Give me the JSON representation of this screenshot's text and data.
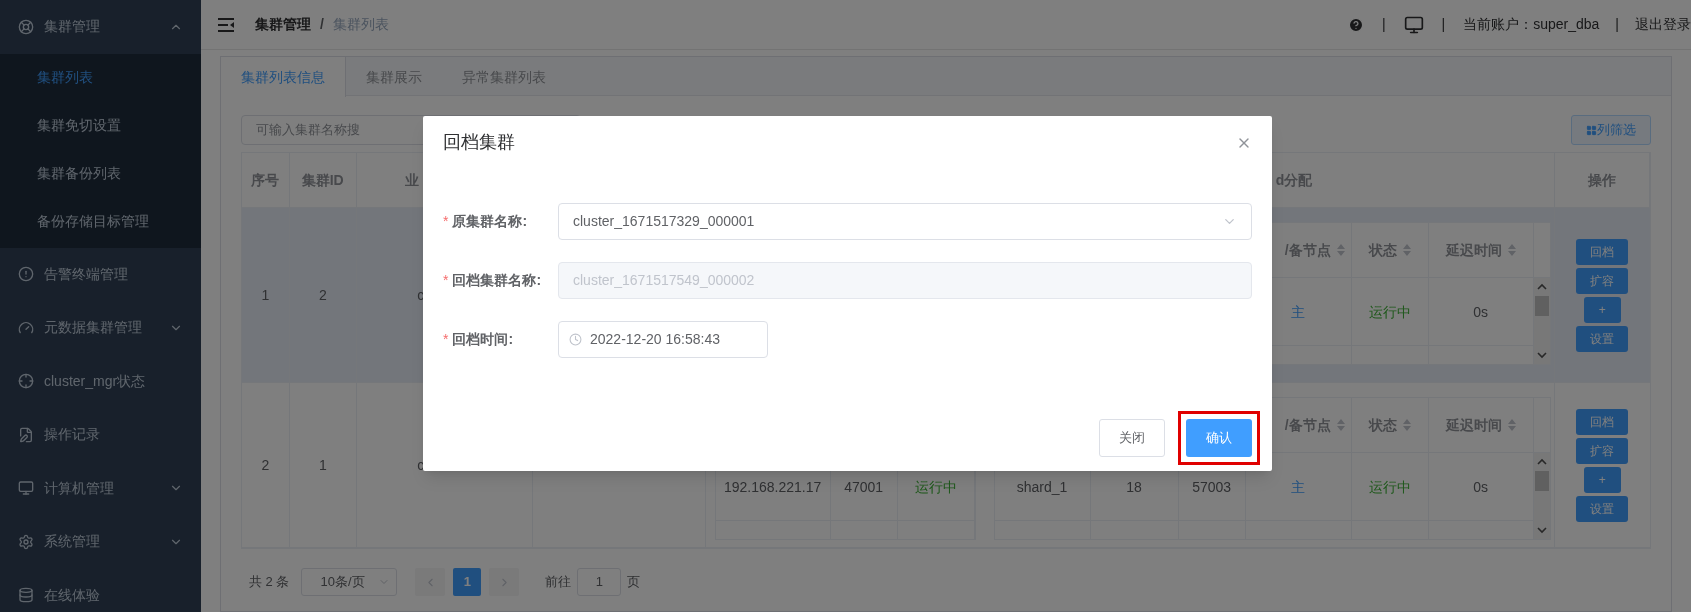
{
  "sidebar": {
    "menu": [
      {
        "label": "集群管理",
        "expanded": true,
        "children": [
          {
            "label": "集群列表",
            "selected": true
          },
          {
            "label": "集群免切设置",
            "selected": false
          },
          {
            "label": "集群备份列表",
            "selected": false
          },
          {
            "label": "备份存储目标管理",
            "selected": false
          }
        ]
      },
      {
        "label": "告警终端管理"
      },
      {
        "label": "元数据集群管理",
        "expanded": false
      },
      {
        "label": "cluster_mgr状态"
      },
      {
        "label": "操作记录"
      },
      {
        "label": "计算机管理",
        "expanded": false
      },
      {
        "label": "系统管理",
        "expanded": false
      },
      {
        "label": "在线体验"
      }
    ]
  },
  "header": {
    "breadcrumb": [
      "集群管理",
      "集群列表"
    ],
    "separator": "/",
    "divider": "|",
    "account": "当前账户：super_dba",
    "logout": "退出登录"
  },
  "tabs": [
    {
      "label": "集群列表信息",
      "selected": true
    },
    {
      "label": "集群展示",
      "selected": false
    },
    {
      "label": "异常集群列表",
      "selected": false
    }
  ],
  "toolbar": {
    "search": {
      "placeholder": "可输入集群名称搜"
    },
    "column_filter": "列筛选"
  },
  "table": {
    "columns": [
      "序号",
      "集群ID",
      "业",
      "",
      "d分配",
      "操作"
    ],
    "rows": [
      {
        "selected": true,
        "cells": [
          "1",
          "2",
          "c",
          ""
        ],
        "left_table": null,
        "right_table": {
          "headers": [
            "/备节点",
            "状态",
            "延迟时间"
          ],
          "cells": [
            {
              "text": "主",
              "kind": "role"
            },
            {
              "text": "运行中",
              "kind": "status"
            },
            {
              "text": "0s",
              "kind": "plain"
            }
          ]
        },
        "actions": [
          "回档",
          "扩容",
          "+",
          "设置"
        ]
      },
      {
        "selected": false,
        "cells": [
          "2",
          "1",
          "c",
          ""
        ],
        "left_table": {
          "cells": [
            {
              "text": "192.168.221.17",
              "kind": "plain"
            },
            {
              "text": "47001",
              "kind": "plain"
            },
            {
              "text": "运行中",
              "kind": "status"
            }
          ]
        },
        "right_table": {
          "headers": [
            "/备节点",
            "状态",
            "延迟时间"
          ],
          "cells": [
            {
              "text": "shard_1",
              "kind": "plain"
            },
            {
              "text": "18",
              "kind": "plain"
            },
            {
              "text": "57003",
              "kind": "plain"
            },
            {
              "text": "主",
              "kind": "role"
            },
            {
              "text": "运行中",
              "kind": "status"
            },
            {
              "text": "0s",
              "kind": "plain"
            }
          ]
        },
        "actions": [
          "回档",
          "扩容",
          "+",
          "设置"
        ]
      }
    ]
  },
  "pagination": {
    "total": "共 2 条",
    "page_size": "10条/页",
    "pages": [
      {
        "label": "1",
        "selected": true
      }
    ],
    "goto_label": "前往",
    "goto_value": "1",
    "page_suffix": "页"
  },
  "dialog": {
    "title": "回档集群",
    "fields": [
      {
        "mark": "*",
        "label": "原集群名称:",
        "kind": "select",
        "value": "cluster_1671517329_000001",
        "disabled": false
      },
      {
        "mark": "*",
        "label": "回档集群名称:",
        "kind": "input",
        "value": "cluster_1671517549_000002",
        "disabled": true
      },
      {
        "mark": "*",
        "label": "回档时间:",
        "kind": "time",
        "value": "2022-12-20 16:58:43",
        "disabled": false
      }
    ],
    "buttons": [
      {
        "label": "关闭",
        "kind": "default",
        "highlighted": false
      },
      {
        "label": "确认",
        "kind": "primary",
        "highlighted": true
      }
    ]
  }
}
